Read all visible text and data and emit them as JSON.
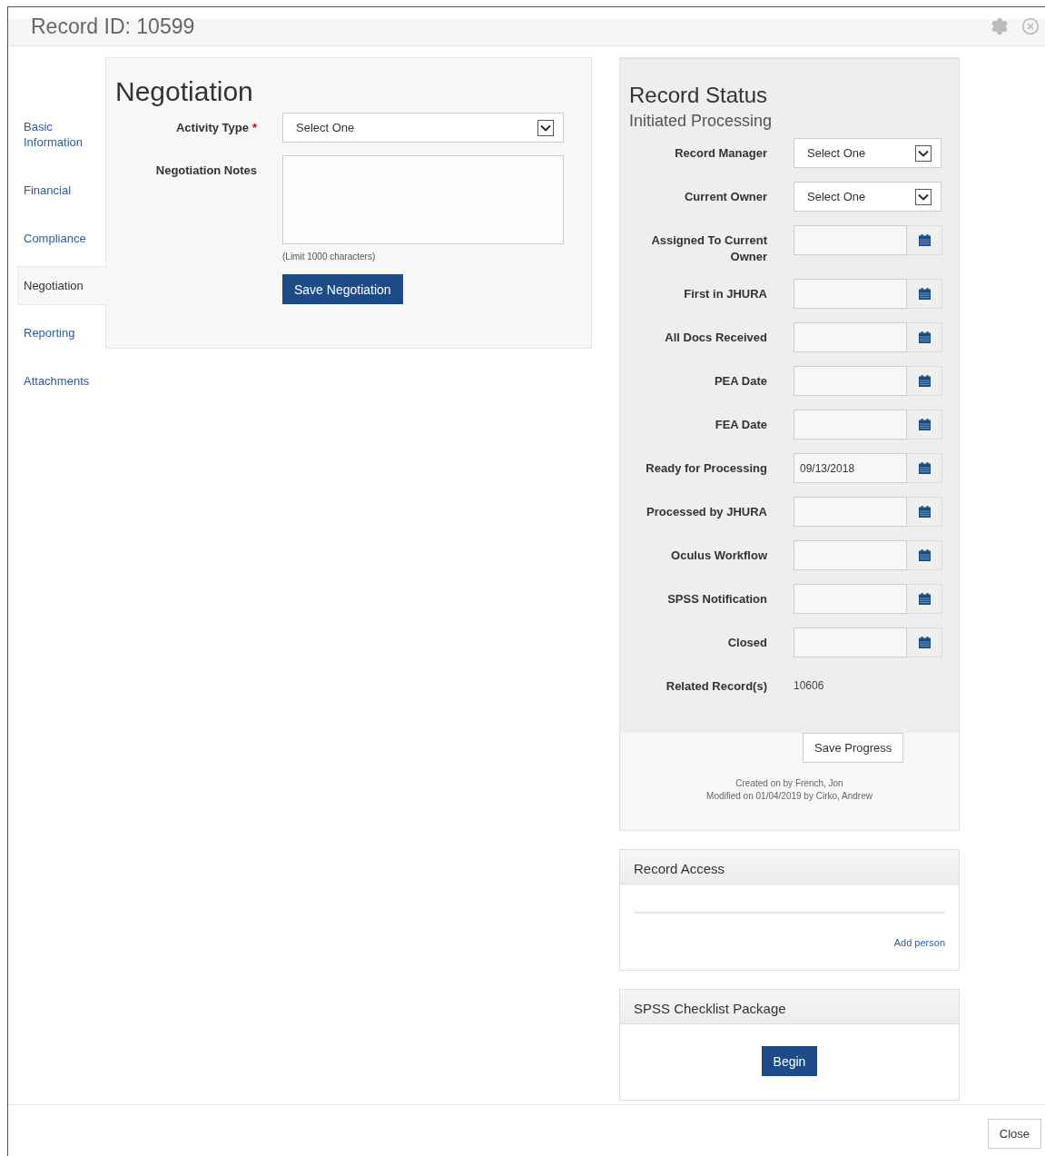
{
  "window": {
    "title": "Record ID: 10599"
  },
  "nav": [
    {
      "label": "Basic Information",
      "selected": false
    },
    {
      "label": "Financial",
      "selected": false
    },
    {
      "label": "Compliance",
      "selected": false
    },
    {
      "label": "Negotiation",
      "selected": true
    },
    {
      "label": "Reporting",
      "selected": false
    },
    {
      "label": "Attachments",
      "selected": false
    }
  ],
  "negotiation": {
    "title": "Negotiation",
    "fields": [
      {
        "kind": "select",
        "label": "Activity Type",
        "required_mark": "*",
        "value": "Select One"
      },
      {
        "kind": "textarea",
        "label": "Negotiation Notes",
        "hint": "(Limit 1000 characters)"
      }
    ],
    "save_button": "Save Negotiation"
  },
  "record_status": {
    "title": "Record Status",
    "subtitle": "Initiated Processing",
    "fields": [
      {
        "kind": "select",
        "label": "Record Manager",
        "value": "Select One"
      },
      {
        "kind": "select",
        "label": "Current Owner",
        "value": "Select One"
      },
      {
        "kind": "date",
        "label": "Assigned To Current Owner"
      },
      {
        "kind": "date",
        "label": "First in JHURA"
      },
      {
        "kind": "date",
        "label": "All Docs Received"
      },
      {
        "kind": "date",
        "label": "PEA Date"
      },
      {
        "kind": "date",
        "label": "FEA Date"
      },
      {
        "kind": "date",
        "label": "Ready for Processing",
        "value": "09/13/2018"
      },
      {
        "kind": "date",
        "label": "Processed by JHURA"
      },
      {
        "kind": "date",
        "label": "Oculus Workflow"
      },
      {
        "kind": "date",
        "label": "SPSS Notification"
      },
      {
        "kind": "date",
        "label": "Closed"
      },
      {
        "kind": "text",
        "label": "Related Record(s)",
        "value": "10606"
      }
    ],
    "save_button": "Save Progress",
    "created": "Created on by French, Jon",
    "modified": "Modified on 01/04/2019 by Cirko, Andrew"
  },
  "record_access": {
    "title": "Record Access",
    "link": "Add person"
  },
  "checklist": {
    "title": "SPSS Checklist Package",
    "button": "Begin"
  },
  "footer": {
    "close_button": "Close"
  }
}
